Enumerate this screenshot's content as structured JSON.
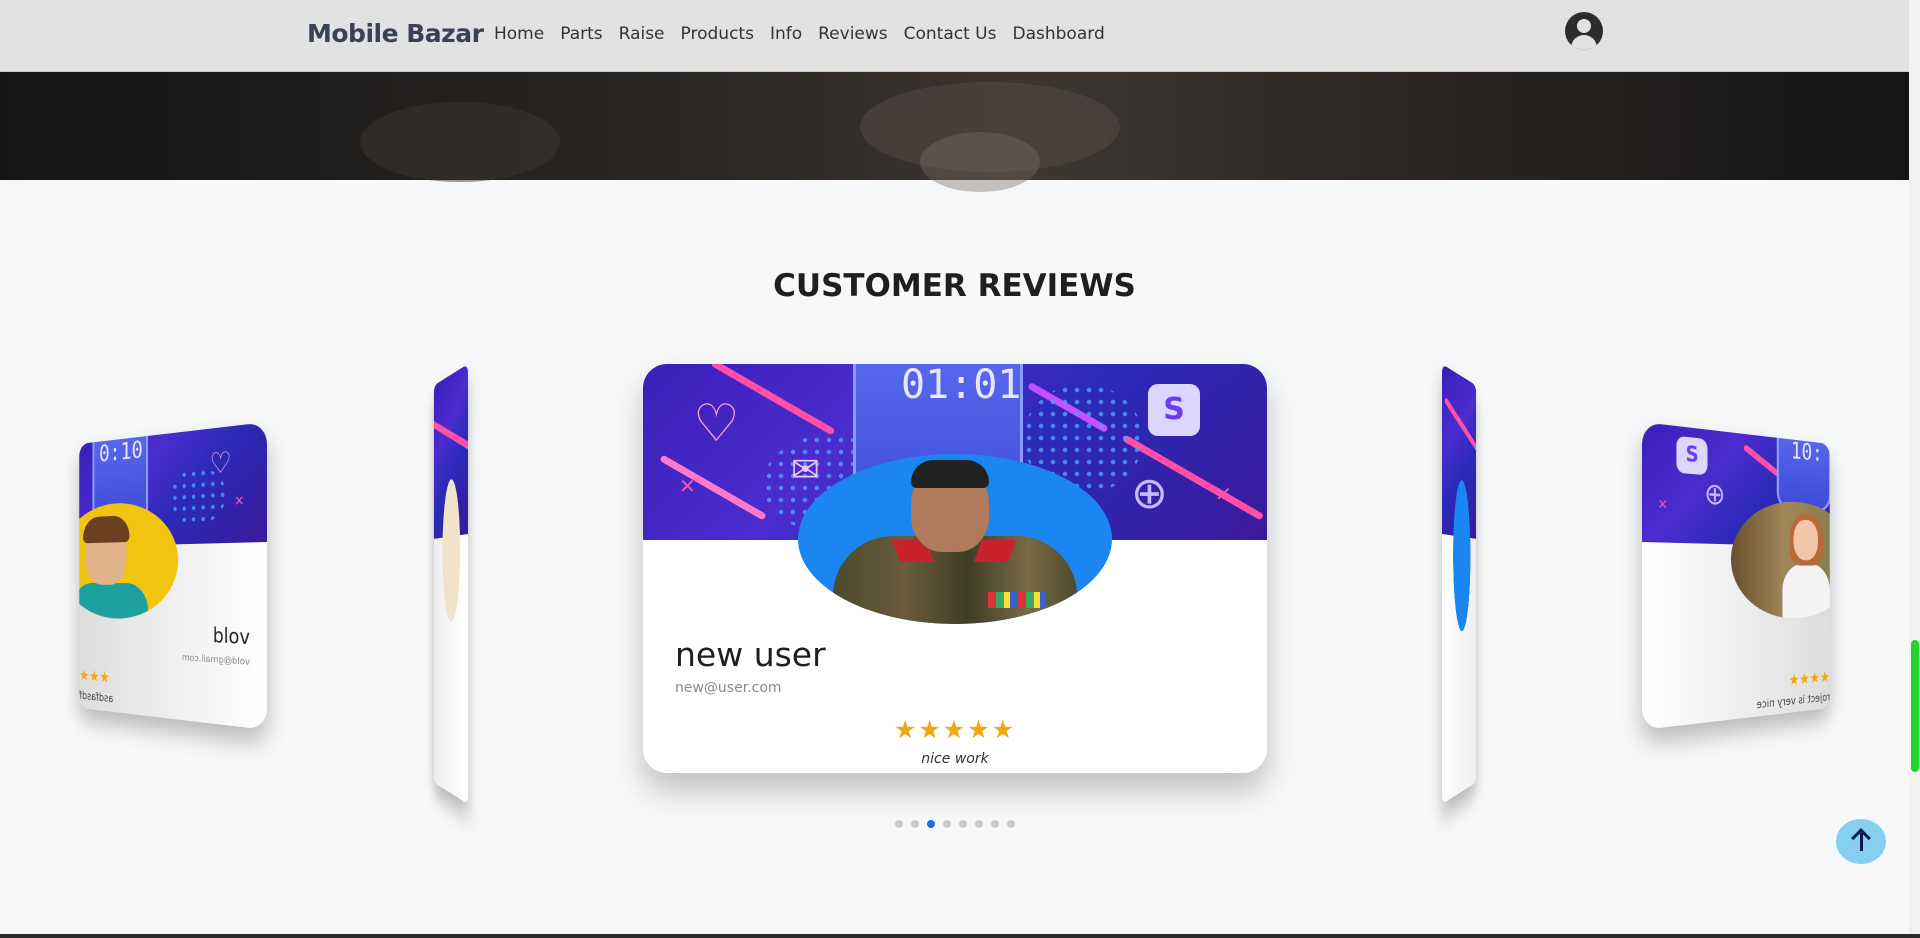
{
  "navbar": {
    "brand": "Mobile Bazar",
    "links": [
      "Home",
      "Parts",
      "Raise",
      "Products",
      "Info",
      "Reviews",
      "Contact Us",
      "Dashboard"
    ]
  },
  "reviews": {
    "section_title": "CUSTOMER REVIEWS",
    "main_card": {
      "name": "new user",
      "email": "new@user.com",
      "stars": "★★★★★",
      "rating": 5,
      "comment": "nice work"
    },
    "far_left_card": {
      "name": "vold",
      "email": "vold@gmail.com",
      "stars": "★★★",
      "comment": "asdfasdf"
    },
    "far_right_card": {
      "stars": "★★★★",
      "comment": "roject is very nice"
    },
    "pagination": {
      "count": 8,
      "active_index": 2
    }
  },
  "colors": {
    "navbar_bg": "#e2e2e2",
    "brand": "#3a4152",
    "star": "#f4a60c",
    "active_dot": "#1e6fd9",
    "to_top_button": "#86cff0",
    "scroll_thumb": "#22d32a"
  },
  "icons": {
    "account": "user-circle-icon",
    "scroll_top": "arrow-up-icon"
  }
}
